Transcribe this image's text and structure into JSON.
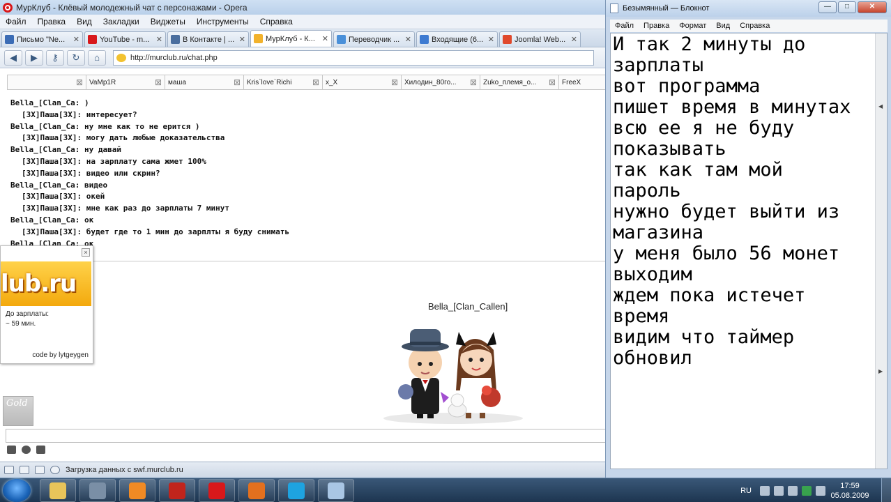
{
  "opera": {
    "title": "МурКлуб - Клёвый молодежный чат с персонажами - Opera",
    "menu": [
      "Файл",
      "Правка",
      "Вид",
      "Закладки",
      "Виджеты",
      "Инструменты",
      "Справка"
    ],
    "tabs": [
      {
        "label": "Письмо \"Ne...",
        "icon": "mail-icon",
        "color": "#3b6cb5"
      },
      {
        "label": "YouTube - m...",
        "icon": "youtube-icon",
        "color": "#d8181b"
      },
      {
        "label": "В Контакте | ...",
        "icon": "vk-icon",
        "color": "#4a6e9e"
      },
      {
        "label": "МурКлуб - К...",
        "icon": "murclub-icon",
        "color": "#f2b22c",
        "active": true
      },
      {
        "label": "Переводчик ...",
        "icon": "translator-icon",
        "color": "#4a90d9"
      },
      {
        "label": "Входящие (6...",
        "icon": "inbox-icon",
        "color": "#3d7ad1"
      },
      {
        "label": "Joomla! Web...",
        "icon": "joomla-icon",
        "color": "#e0482b"
      }
    ],
    "url": "http://murclub.ru/chat.php",
    "status": "Загрузка данных с swf.murclub.ru"
  },
  "chat": {
    "user_tabs": [
      "",
      "VaMp1R",
      "маша",
      "Kris`love`Richi",
      "x_X",
      "Хилодин_80го...",
      "Zuko_племя_о...",
      "FreeX"
    ],
    "messages": [
      {
        "text": "Bella_[Clan_Ca: )",
        "indent": false
      },
      {
        "text": "[ЗХ]Паша[ЗХ]: интересует?",
        "indent": true
      },
      {
        "text": "Bella_[Clan_Ca: ну мне как то не ерится )",
        "indent": false
      },
      {
        "text": "[ЗХ]Паша[ЗХ]: могу дать любые доказательства",
        "indent": true
      },
      {
        "text": "Bella_[Clan_Ca: ну давай",
        "indent": false
      },
      {
        "text": "[ЗХ]Паша[ЗХ]: на зарплату сама жмет 100%",
        "indent": true
      },
      {
        "text": "[ЗХ]Паша[ЗХ]: видео или скрин?",
        "indent": true
      },
      {
        "text": "Bella_[Clan_Ca: видео",
        "indent": false
      },
      {
        "text": "[ЗХ]Паша[ЗХ]: окей",
        "indent": true
      },
      {
        "text": "[ЗХ]Паша[ЗХ]: мне как раз до зарплаты 7 минут",
        "indent": true
      },
      {
        "text": "Bella_[Clan_Ca: ок",
        "indent": false
      },
      {
        "text": "[ЗХ]Паша[ЗХ]: будет где то 1 мин до зарплты я буду снимать",
        "indent": true
      },
      {
        "text": "Bella_[Clan_Ca: ок",
        "indent": false
      }
    ],
    "avatar_nick": "Bella_[Clan_Callen]",
    "gold_badge": "Gold"
  },
  "widget": {
    "logo": "lub.ru",
    "line1": "До зарплаты:",
    "line2": "~ 59 мин.",
    "credit": "code by lytgeygen"
  },
  "notepad": {
    "title": "Безымянный — Блокнот",
    "menu": [
      "Файл",
      "Правка",
      "Формат",
      "Вид",
      "Справка"
    ],
    "text": "И так 2 минуты до\nзарплаты\nвот программа\nпишет время в минутах\nвсю ее я не буду\nпоказывать\nтак как там мой\nпароль\nнужно будет выйти из\nмагазина\nу меня было 56 монет\nвыходим\nждем пока истечет\nвремя\nвидим что таймер\nобновил"
  },
  "taskbar": {
    "lang": "RU",
    "time": "17:59",
    "date": "05.08.2009",
    "apps": [
      {
        "name": "explorer-icon",
        "color": "#e8c45a"
      },
      {
        "name": "ink-icon",
        "color": "#7a8fa6"
      },
      {
        "name": "media-player-icon",
        "color": "#f08a24"
      },
      {
        "name": "filezilla-icon",
        "color": "#c0241c"
      },
      {
        "name": "opera-icon",
        "color": "#d8181b"
      },
      {
        "name": "firefox-icon",
        "color": "#e3701e"
      },
      {
        "name": "skype-icon",
        "color": "#1ea3e0"
      },
      {
        "name": "notepad-icon",
        "color": "#a9c6e4"
      }
    ]
  }
}
